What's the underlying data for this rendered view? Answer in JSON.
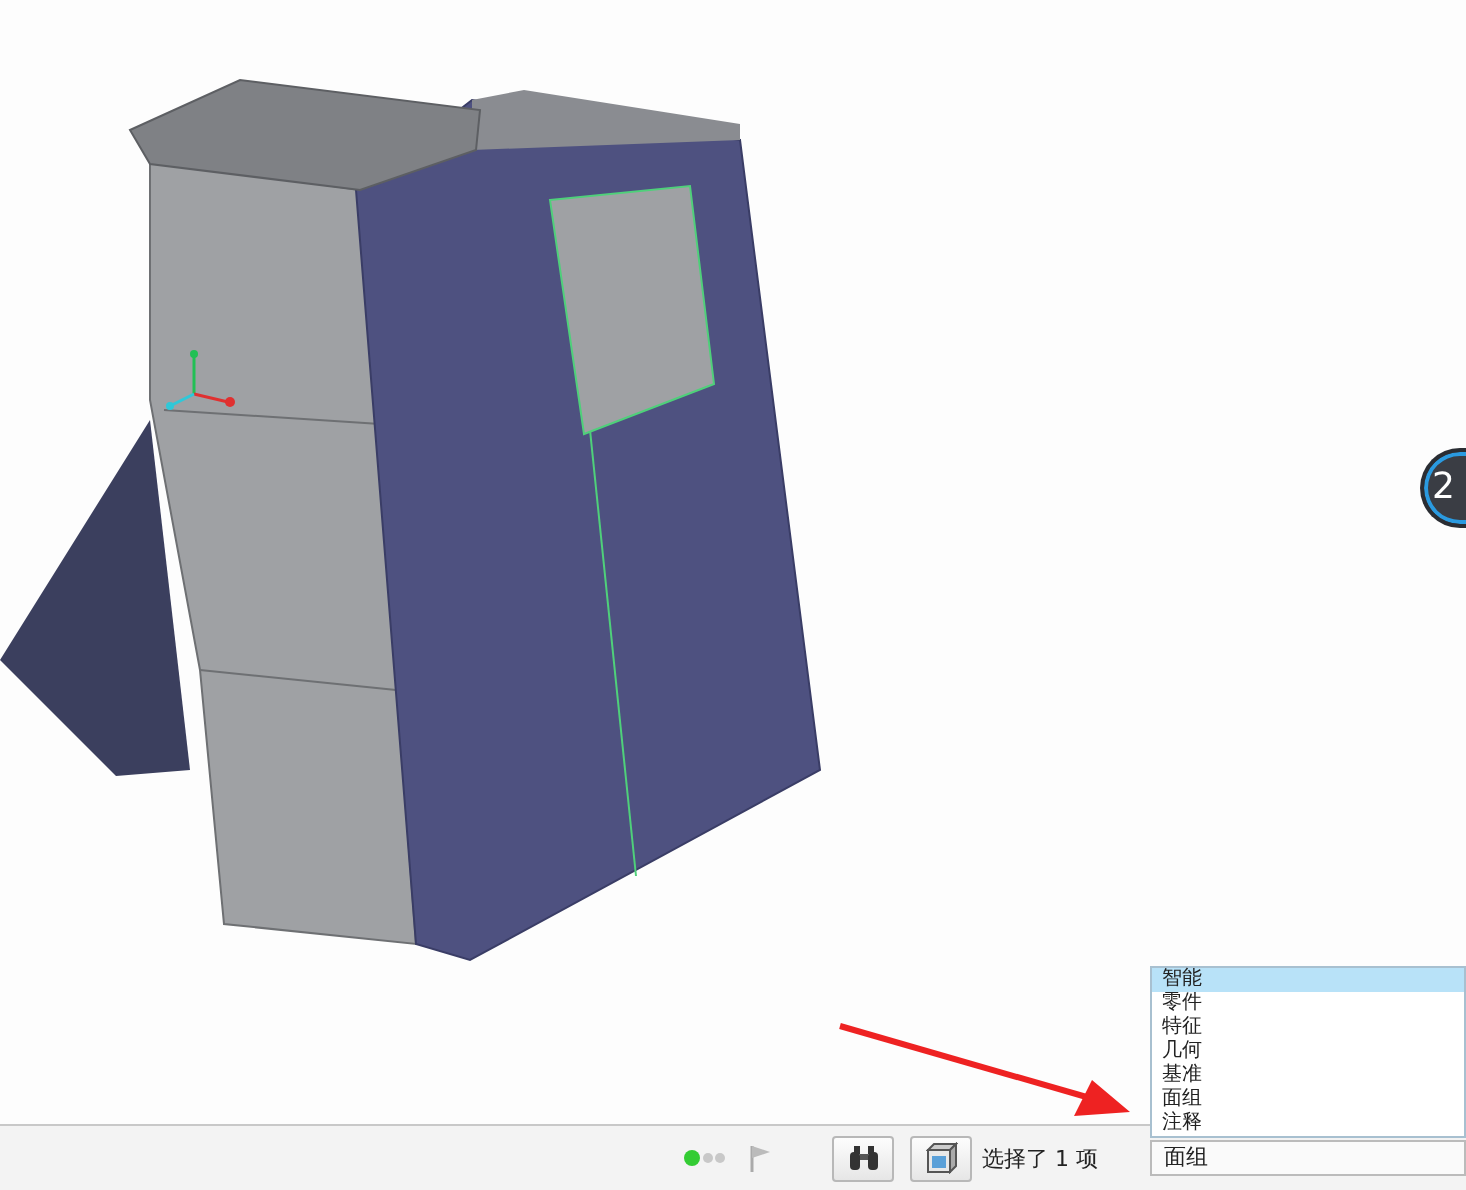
{
  "viewport": {
    "badge": "2"
  },
  "status_bar": {
    "selection_text": "选择了 1 项",
    "filter": {
      "value": "面组",
      "expanded": true,
      "options": [
        {
          "label": "智能",
          "highlighted": true
        },
        {
          "label": "零件",
          "highlighted": false
        },
        {
          "label": "特征",
          "highlighted": false
        },
        {
          "label": "几何",
          "highlighted": false
        },
        {
          "label": "基准",
          "highlighted": false
        },
        {
          "label": "面组",
          "highlighted": false
        },
        {
          "label": "注释",
          "highlighted": false
        }
      ]
    }
  }
}
